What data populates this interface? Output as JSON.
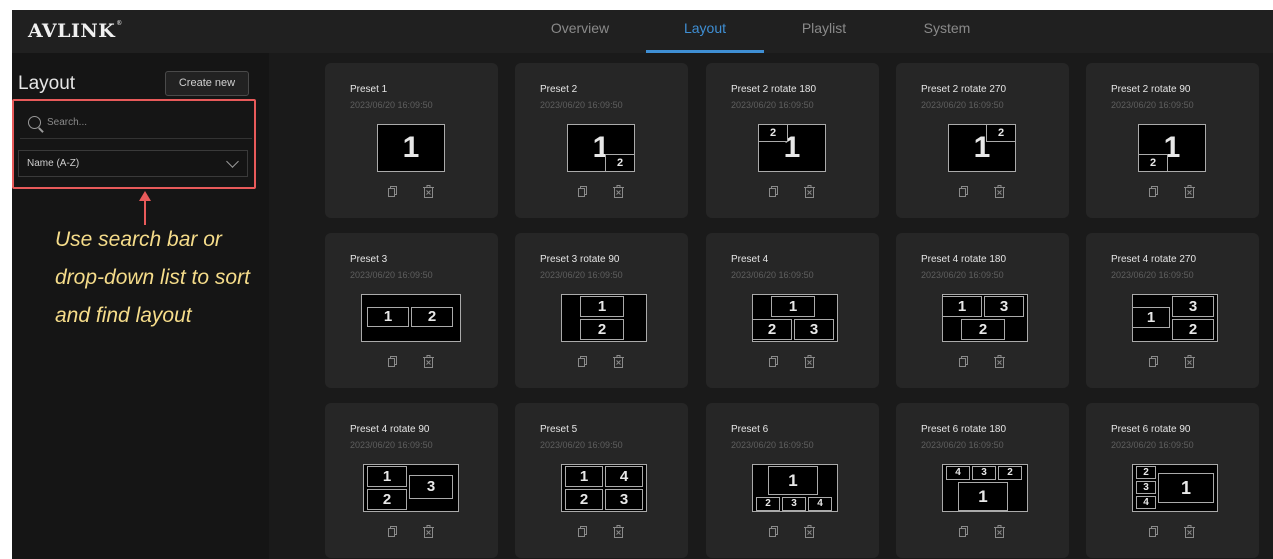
{
  "app": {
    "logo_text": "AVLINK",
    "logo_mark": "®"
  },
  "nav": {
    "tabs": [
      {
        "label": "Overview",
        "active": false
      },
      {
        "label": "Layout",
        "active": true
      },
      {
        "label": "Playlist",
        "active": false
      },
      {
        "label": "System",
        "active": false
      }
    ]
  },
  "sidebar": {
    "title": "Layout",
    "create_label": "Create new",
    "search_placeholder": "Search...",
    "sort_value": "Name (A-Z)",
    "annotation": "Use search bar or drop-down list to sort and find layout",
    "highlight_color": "#e85a5a",
    "annotation_color": "#f5dc8a"
  },
  "colors": {
    "accent": "#3f8fd4",
    "card": "#262626"
  },
  "presets": [
    {
      "name": "Preset 1",
      "date": "2023/06/20 16:09:50",
      "numbers": [
        "1"
      ]
    },
    {
      "name": "Preset 2",
      "date": "2023/06/20 16:09:50",
      "numbers": [
        "1",
        "2"
      ]
    },
    {
      "name": "Preset 2 rotate 180",
      "date": "2023/06/20 16:09:50",
      "numbers": [
        "2",
        "1"
      ]
    },
    {
      "name": "Preset 2 rotate 270",
      "date": "2023/06/20 16:09:50",
      "numbers": [
        "1",
        "2"
      ]
    },
    {
      "name": "Preset 2 rotate 90",
      "date": "2023/06/20 16:09:50",
      "numbers": [
        "2",
        "1"
      ]
    },
    {
      "name": "Preset 3",
      "date": "2023/06/20 16:09:50",
      "numbers": [
        "1",
        "2"
      ]
    },
    {
      "name": "Preset 3 rotate 90",
      "date": "2023/06/20 16:09:50",
      "numbers": [
        "1",
        "2"
      ]
    },
    {
      "name": "Preset 4",
      "date": "2023/06/20 16:09:50",
      "numbers": [
        "1",
        "2",
        "3"
      ]
    },
    {
      "name": "Preset 4 rotate 180",
      "date": "2023/06/20 16:09:50",
      "numbers": [
        "1",
        "3",
        "2"
      ]
    },
    {
      "name": "Preset 4 rotate 270",
      "date": "2023/06/20 16:09:50",
      "numbers": [
        "3",
        "1",
        "2"
      ]
    },
    {
      "name": "Preset 4 rotate 90",
      "date": "2023/06/20 16:09:50",
      "numbers": [
        "1",
        "3",
        "2"
      ]
    },
    {
      "name": "Preset 5",
      "date": "2023/06/20 16:09:50",
      "numbers": [
        "1",
        "4",
        "2",
        "3"
      ]
    },
    {
      "name": "Preset 6",
      "date": "2023/06/20 16:09:50",
      "numbers": [
        "1",
        "2",
        "3",
        "4"
      ]
    },
    {
      "name": "Preset 6 rotate 180",
      "date": "2023/06/20 16:09:50",
      "numbers": [
        "4",
        "3",
        "2",
        "1"
      ]
    },
    {
      "name": "Preset 6 rotate 90",
      "date": "2023/06/20 16:09:50",
      "numbers": [
        "2",
        "3",
        "4",
        "1"
      ]
    }
  ]
}
